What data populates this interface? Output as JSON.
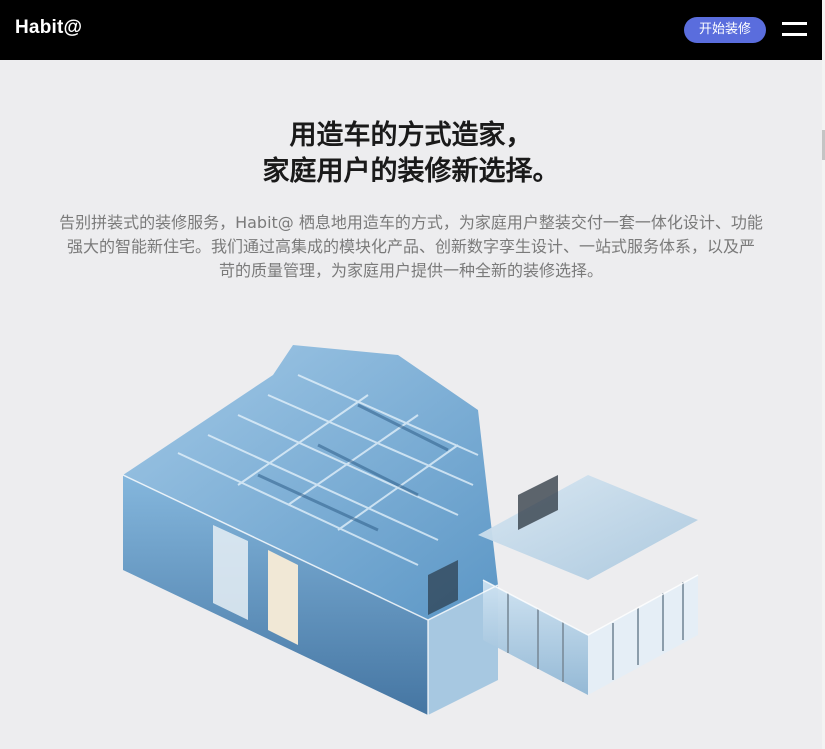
{
  "header": {
    "logo": "Habit@",
    "cta_label": "开始装修",
    "menu_icon": "hamburger-menu-icon"
  },
  "hero": {
    "headline_line1": "用造车的方式造家，",
    "headline_line2": "家庭用户的装修新选择。",
    "intro_line1": "告别拼装式的装修服务，Habit@ 栖息地用造车的方式，为家庭用户整装交付一套一体化设计、功能",
    "intro_line2": "强大的智能新住宅。我们通过高集成的模块化产品、创新数字孪生设计、一站式服务体系，以及严",
    "intro_line3": "苛的质量管理，为家庭用户提供一种全新的装修选择。"
  },
  "colors": {
    "accent": "#5a6ddd",
    "topbar": "#000000",
    "background": "#ededef",
    "glass_blue": "#6fa9d6"
  }
}
